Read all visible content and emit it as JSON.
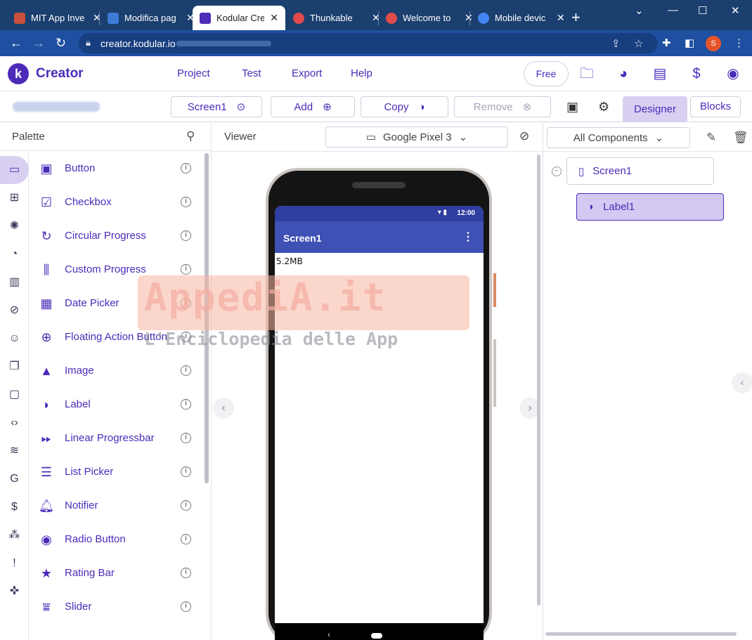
{
  "browser": {
    "tabs": [
      {
        "title": "MIT App Inve",
        "color": "#c9503b"
      },
      {
        "title": "Modifica pag",
        "color": "#3d7bd6"
      },
      {
        "title": "Kodular Crea",
        "color": "#4b2bb8"
      },
      {
        "title": "Thunkable",
        "color": "#e04a4a"
      },
      {
        "title": "Welcome to",
        "color": "#e04a4a"
      },
      {
        "title": "Mobile devic",
        "color": "#4285f4"
      }
    ],
    "url": "creator.kodular.io",
    "profile_initial": "S"
  },
  "header": {
    "brand": "Creator",
    "logo_letter": "k",
    "menu": [
      "Project",
      "Test",
      "Export",
      "Help"
    ],
    "plan_button": "Free"
  },
  "toolbar": {
    "screen_select": "Screen1",
    "add": "Add",
    "copy": "Copy",
    "remove": "Remove",
    "designer": "Designer",
    "blocks": "Blocks"
  },
  "palette": {
    "title": "Palette",
    "components": [
      {
        "name": "Button",
        "icon": "button-icon"
      },
      {
        "name": "Checkbox",
        "icon": "checkbox-icon"
      },
      {
        "name": "Circular Progress",
        "icon": "circular-progress-icon"
      },
      {
        "name": "Custom Progress",
        "icon": "custom-progress-icon"
      },
      {
        "name": "Date Picker",
        "icon": "date-picker-icon"
      },
      {
        "name": "Floating Action Button",
        "icon": "fab-icon"
      },
      {
        "name": "Image",
        "icon": "image-icon"
      },
      {
        "name": "Label",
        "icon": "label-icon"
      },
      {
        "name": "Linear Progressbar",
        "icon": "linear-progressbar-icon"
      },
      {
        "name": "List Picker",
        "icon": "list-picker-icon"
      },
      {
        "name": "Notifier",
        "icon": "notifier-icon"
      },
      {
        "name": "Radio Button",
        "icon": "radio-button-icon"
      },
      {
        "name": "Rating Bar",
        "icon": "rating-bar-icon"
      },
      {
        "name": "Slider",
        "icon": "slider-icon"
      }
    ]
  },
  "viewer": {
    "title": "Viewer",
    "device": "Google Pixel 3",
    "phone": {
      "status_time": "12:00",
      "screen_title": "Screen1",
      "label_text": "5.2MB"
    }
  },
  "watermark": {
    "title": "AppediA.it",
    "subtitle": "L'Enciclopedia delle App"
  },
  "tree": {
    "filter": "All Components",
    "nodes": [
      "Screen1",
      "Label1"
    ]
  },
  "colors": {
    "accent": "#4b2bb8",
    "accent_light": "#d8cff1",
    "appbar": "#3f51b5"
  }
}
